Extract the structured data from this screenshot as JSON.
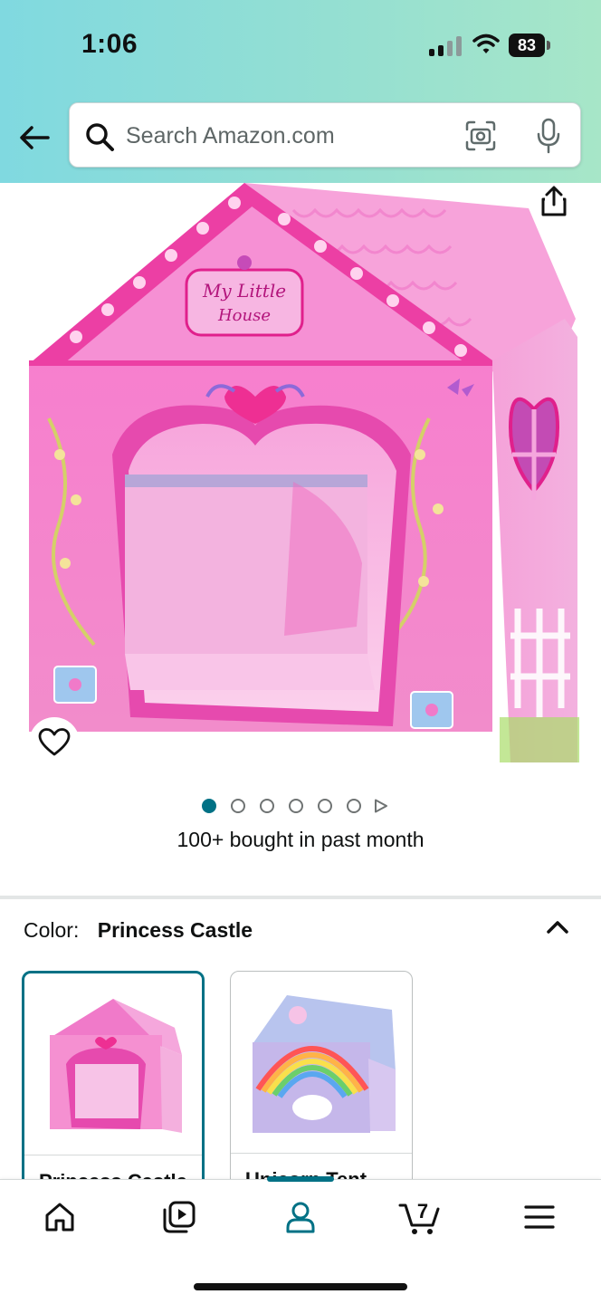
{
  "status_bar": {
    "time": "1:06",
    "battery": "83"
  },
  "header": {
    "back_icon": "back-arrow-icon",
    "search": {
      "placeholder": "Search Amazon.com",
      "value": ""
    },
    "camera_icon": "camera-scan-icon",
    "mic_icon": "microphone-icon"
  },
  "product": {
    "image_alt": "Pink princess play tent house with My Little House sign",
    "sign_line1": "My Little",
    "sign_line2": "House",
    "share_icon": "share-icon",
    "wishlist_icon": "heart-icon",
    "carousel": {
      "total_images": 6,
      "active_index": 0,
      "has_video": true
    },
    "bought_text": "100+ bought in past month"
  },
  "variation": {
    "label": "Color:",
    "selected_value": "Princess Castle",
    "options": [
      {
        "label": "Princess Castle",
        "selected": true
      },
      {
        "label": "Unicorn Tent",
        "selected": false
      }
    ]
  },
  "bottom_nav": {
    "items": [
      {
        "name": "home",
        "icon": "home-icon"
      },
      {
        "name": "video",
        "icon": "video-icon"
      },
      {
        "name": "account",
        "icon": "account-icon",
        "active": true
      },
      {
        "name": "cart",
        "icon": "cart-icon",
        "count": "7"
      },
      {
        "name": "menu",
        "icon": "menu-icon"
      }
    ]
  },
  "colors": {
    "accent": "#007185",
    "pink": "#f07ec4",
    "deep_pink": "#e0208c"
  }
}
